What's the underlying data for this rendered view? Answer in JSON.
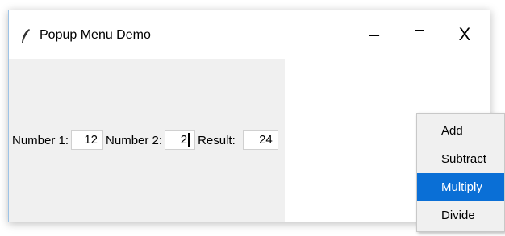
{
  "window": {
    "title": "Popup Menu Demo",
    "minimize_glyph": "–",
    "close_glyph": "X"
  },
  "form": {
    "number1_label": "Number 1:",
    "number1_value": "12",
    "number2_label": "Number 2:",
    "number2_value": "2",
    "result_label": "Result:",
    "result_value": "24"
  },
  "popup_menu": {
    "items": [
      {
        "label": "Add"
      },
      {
        "label": "Subtract"
      },
      {
        "label": "Multiply",
        "selected": true
      },
      {
        "label": "Divide"
      }
    ],
    "selected_color": "#0a6fd6"
  },
  "icons": {
    "app": "feather-icon",
    "minimize": "minimize-icon",
    "maximize": "maximize-icon",
    "close": "close-icon"
  }
}
